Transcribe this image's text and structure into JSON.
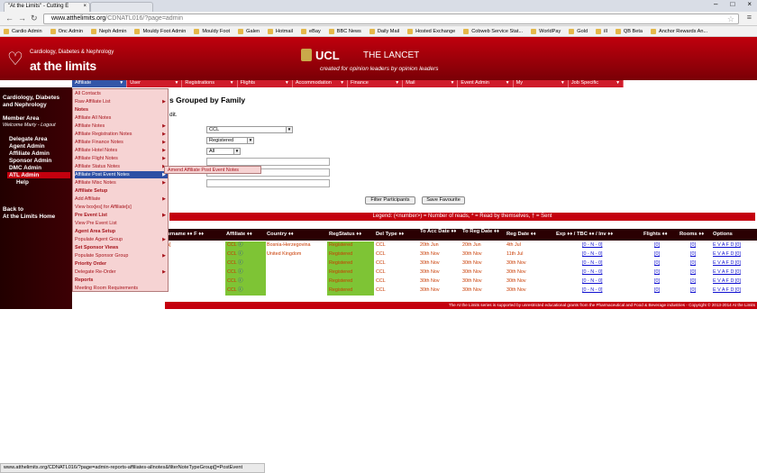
{
  "browser": {
    "tabs": [
      {
        "title": "\"At the Limits\" - Cutting E"
      },
      {
        "title": ""
      }
    ],
    "url_host": "www.atthelimits.org",
    "url_rest": "/CDNATL016/?page=admin",
    "bookmarks": [
      "Cardio Admin",
      "Onc Admin",
      "Neph Admin",
      "Mouldy Foot Admin",
      "Mouldy Foot",
      "Galen",
      "Hotmail",
      "eBay",
      "BBC News",
      "Daily Mail",
      "Hosted Exchange",
      "Cobweb Service Stat...",
      "WorldPay",
      "Gold",
      "ill",
      "QB Beta",
      "Anchor Rewards An..."
    ],
    "status_url": "www.atthelimits.org/CDNATL016/?page=admin-reports-affiliates-allnotes&filterNoteTypeGroup[]=PostEvent"
  },
  "header": {
    "logo_top": "Cardiology, Diabetes & Nephrology",
    "logo_main": "at the limits",
    "ucl": "UCL",
    "lancet": "THE LANCET",
    "slogan": "created for opinion leaders by opinion leaders"
  },
  "topmenu": [
    "Affiliate",
    "User",
    "Registrations",
    "Flights",
    "Accommodation",
    "Finance",
    "Mail",
    "Event Admin",
    "My",
    "Job Specific"
  ],
  "sidebar": {
    "site": "Cardiology, Diabetes and Nephrology",
    "member_area": "Member Area",
    "welcome": "Welcome Marty - Logout",
    "links": [
      "Delegate Area",
      "Agent Admin",
      "Affiliate Admin",
      "Sponsor Admin",
      "DMC Admin",
      "ATL Admin",
      "Help"
    ],
    "back": "Back to",
    "back2": "At the Limits Home"
  },
  "dropdown": [
    {
      "label": "All Contacts",
      "bold": false,
      "arrow": false
    },
    {
      "label": "Raw Affiliate List",
      "bold": false,
      "arrow": true
    },
    {
      "label": "Notes",
      "bold": true,
      "arrow": false
    },
    {
      "label": "Affiliate All Notes",
      "bold": false,
      "arrow": false
    },
    {
      "label": "Affiliate Notes",
      "bold": false,
      "arrow": true
    },
    {
      "label": "Affiliate Registration Notes",
      "bold": false,
      "arrow": true
    },
    {
      "label": "Affiliate Finance Notes",
      "bold": false,
      "arrow": true
    },
    {
      "label": "Affiliate Hotel Notes",
      "bold": false,
      "arrow": true
    },
    {
      "label": "Affiliate Flight Notes",
      "bold": false,
      "arrow": true
    },
    {
      "label": "Affiliate Status Notes",
      "bold": false,
      "arrow": true
    },
    {
      "label": "Affiliate Post Event Notes",
      "bold": false,
      "arrow": true,
      "highlight": true
    },
    {
      "label": "Affiliate Misc Notes",
      "bold": false,
      "arrow": true
    },
    {
      "label": "Affiliate Setup",
      "bold": true,
      "arrow": false
    },
    {
      "label": "Add Affiliate",
      "bold": false,
      "arrow": true
    },
    {
      "label": "View box[es] for Affiliate[s]",
      "bold": false,
      "arrow": false
    },
    {
      "label": "Pre Event List",
      "bold": true,
      "arrow": true
    },
    {
      "label": "View Pre Event List",
      "bold": false,
      "arrow": false
    },
    {
      "label": "Agent Area Setup",
      "bold": true,
      "arrow": false
    },
    {
      "label": "Populate Agent Group",
      "bold": false,
      "arrow": true
    },
    {
      "label": "Set Sponsor Views",
      "bold": true,
      "arrow": false
    },
    {
      "label": "Populate Sponsor Group",
      "bold": false,
      "arrow": true
    },
    {
      "label": "Priority Order",
      "bold": true,
      "arrow": false
    },
    {
      "label": "Delegate Re-Order",
      "bold": false,
      "arrow": true
    },
    {
      "label": "Reports",
      "bold": true,
      "arrow": false
    },
    {
      "label": "Meeting Room Requirements",
      "bold": false,
      "arrow": false
    }
  ],
  "submenu": "Amend Affiliate Post Event Notes",
  "main": {
    "title": "s Grouped by Family",
    "subtitle": "dit.",
    "select1": "CCL",
    "select2": "Registered",
    "select3": "All",
    "filter_btn": "Filter Participants",
    "save_btn": "Save Favourite",
    "legend": "Legend: (<number>) = Number of reads, * = Read by themselves, † = Sent"
  },
  "table": {
    "headers": [
      "urname ♦♦ F ♦♦",
      "Affiliate ♦♦",
      "Country ♦♦",
      "RegStatus ♦♦",
      "Del Type ♦♦",
      "To Acc Date ♦♦",
      "To Reg Date ♦♦",
      "Reg Date ♦♦",
      "Exp ♦♦ / TBC ♦♦ / Inv ♦♦",
      "Flights ♦♦",
      "Rooms ♦♦",
      "Options"
    ],
    "rows": [
      {
        "name": "a]",
        "aff": "CCL",
        "country": "Bosnia-Herzegovina",
        "status": "Registered",
        "type": "CCL",
        "acc": "20th Jun",
        "reg": "20th Jun",
        "regdate": "4th Jul",
        "exp": "[0 - N - 0]",
        "fl": "[0]",
        "rm": "[0]",
        "opt": "E V A F D [0]"
      },
      {
        "name": "",
        "aff": "CCL",
        "country": "United Kingdom",
        "status": "Registered",
        "type": "CCL",
        "acc": "30th Nov",
        "reg": "30th Nov",
        "regdate": "11th Jul",
        "exp": "[0 - N - 0]",
        "fl": "[0]",
        "rm": "[0]",
        "opt": "E V A F D [0]"
      },
      {
        "name": "",
        "aff": "CCL",
        "country": "",
        "status": "Registered",
        "type": "CCL",
        "acc": "30th Nov",
        "reg": "30th Nov",
        "regdate": "30th Nov",
        "exp": "[0 - N - 0]",
        "fl": "[0]",
        "rm": "[0]",
        "opt": "E V A F D [0]"
      },
      {
        "name": "",
        "aff": "CCL",
        "country": "",
        "status": "Registered",
        "type": "CCL",
        "acc": "30th Nov",
        "reg": "30th Nov",
        "regdate": "30th Nov",
        "exp": "[0 - N - 0]",
        "fl": "[0]",
        "rm": "[0]",
        "opt": "E V A F D [0]"
      },
      {
        "name": "",
        "aff": "CCL",
        "country": "",
        "status": "Registered",
        "type": "CCL",
        "acc": "30th Nov",
        "reg": "30th Nov",
        "regdate": "30th Nov",
        "exp": "[0 - N - 0]",
        "fl": "[0]",
        "rm": "[0]",
        "opt": "E V A F D [0]"
      },
      {
        "name": "",
        "aff": "CCL",
        "country": "",
        "status": "Registered",
        "type": "CCL",
        "acc": "30th Nov",
        "reg": "30th Nov",
        "regdate": "30th Nov",
        "exp": "[0 - N - 0]",
        "fl": "[0]",
        "rm": "[0]",
        "opt": "E V A F D [0]"
      }
    ]
  },
  "footer": "The At the Limits series is supported by unrestricted educational grants from the Pharmaceutical and Food & Beverage industries - Copyright © 2013-2014 At the Limits"
}
